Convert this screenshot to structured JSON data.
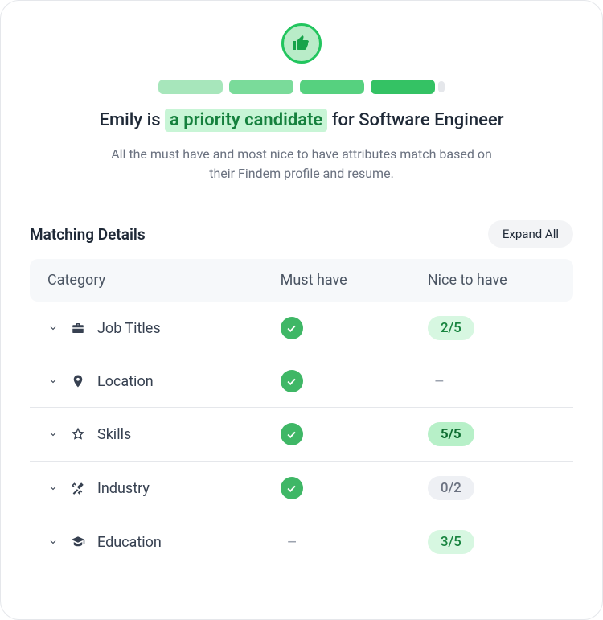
{
  "hero": {
    "segment_colors": [
      "#a7e6bb",
      "#7adb9a",
      "#56d17f",
      "#34c264"
    ],
    "headline_prefix": "Emily is",
    "headline_highlight": "a priority candidate",
    "headline_suffix": "for Software Engineer",
    "subtext": "All the must have and most nice to have attributes match based on their Findem profile and resume."
  },
  "details": {
    "title": "Matching Details",
    "expand_label": "Expand All",
    "headers": {
      "category": "Category",
      "must": "Must have",
      "nice": "Nice to have"
    }
  },
  "rows": [
    {
      "icon": "briefcase",
      "label": "Job Titles",
      "must": "check",
      "nice_text": "2/5",
      "nice_style": "green"
    },
    {
      "icon": "location",
      "label": "Location",
      "must": "check",
      "nice_text": "–",
      "nice_style": "dash"
    },
    {
      "icon": "star",
      "label": "Skills",
      "must": "check",
      "nice_text": "5/5",
      "nice_style": "green-strong"
    },
    {
      "icon": "tools",
      "label": "Industry",
      "must": "check",
      "nice_text": "0/2",
      "nice_style": "gray"
    },
    {
      "icon": "education",
      "label": "Education",
      "must": "dash",
      "nice_text": "3/5",
      "nice_style": "green"
    }
  ]
}
